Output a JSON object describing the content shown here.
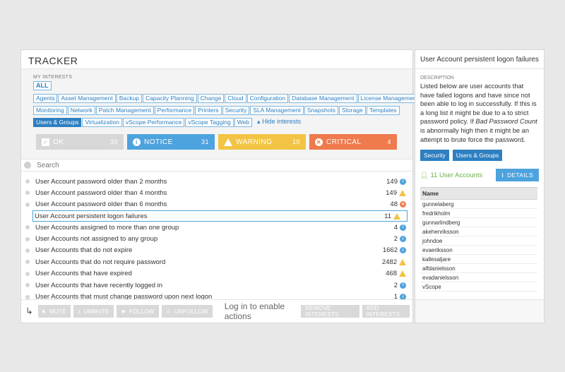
{
  "tracker": {
    "title": "TRACKER",
    "interests_label": "MY INTERESTS",
    "all_label": "ALL",
    "interest_rows": [
      [
        "Agents",
        "Asset Management",
        "Backup",
        "Capacity Planning",
        "Change",
        "Cloud",
        "Configuration",
        "Database Management",
        "License Management"
      ],
      [
        "Monitoring",
        "Network",
        "Patch Management",
        "Performance",
        "Printers",
        "Security",
        "SLA Management",
        "Snapshots",
        "Storage",
        "Templates"
      ],
      [
        "Users & Groups",
        "Virtualization",
        "vScope Performance",
        "vScope Tagging",
        "Web"
      ]
    ],
    "selected_interest": "Users & Groups",
    "hide_interests": "Hide interests",
    "severity": {
      "ok": {
        "label": "OK",
        "count": "30",
        "color": "#d7d7d7"
      },
      "notice": {
        "label": "NOTICE",
        "count": "31",
        "color": "#4da3de"
      },
      "warning": {
        "label": "WARNING",
        "count": "10",
        "color": "#f3c443"
      },
      "critical": {
        "label": "CRITICAL",
        "count": "4",
        "color": "#ef7a4d"
      }
    },
    "search_placeholder": "Search",
    "rows": [
      {
        "label": "User Account password older than 2 months",
        "count": "149",
        "sev": "notice"
      },
      {
        "label": "User Account password older than 4 months",
        "count": "149",
        "sev": "warning"
      },
      {
        "label": "User Account password older than 6 months",
        "count": "48",
        "sev": "critical"
      },
      {
        "label": "User Account persistent logon failures",
        "count": "11",
        "sev": "warning",
        "selected": true
      },
      {
        "label": "User Accounts assigned to more than one group",
        "count": "4",
        "sev": "notice"
      },
      {
        "label": "User Accounts not assigned to any group",
        "count": "2",
        "sev": "notice"
      },
      {
        "label": "User Accounts that do not expire",
        "count": "1662",
        "sev": "notice"
      },
      {
        "label": "User Accounts that do not require password",
        "count": "2482",
        "sev": "warning"
      },
      {
        "label": "User Accounts that have expired",
        "count": "468",
        "sev": "warning"
      },
      {
        "label": "User Accounts that have recently logged in",
        "count": "2",
        "sev": "notice"
      },
      {
        "label": "User Accounts that must change password upon next logon",
        "count": "1",
        "sev": "notice"
      }
    ],
    "footer": {
      "mute": "MUTE",
      "unmute": "UNMUTE",
      "follow": "FOLLOW",
      "unfollow": "UNFOLLOW",
      "login_note": "Log in to enable actions",
      "remove_interests": "REMOVE INTERESTS",
      "add_interests": "ADD INTERESTS"
    }
  },
  "detail": {
    "title": "User Account persistent logon failures",
    "description_label": "DESCRIPTION",
    "description_part1": "Listed below are user accounts that have failed logons and have since not been able to log in successfully. If this is a long list it might be due to a to strict password policy. If ",
    "description_em": "Bad Password Count",
    "description_part2": " is abnormally high then it might be an attempt to brute force the password.",
    "tags": [
      "Security",
      "Users & Groups"
    ],
    "accounts_text": "11 User Accounts",
    "details_button": "DETAILS",
    "table_header": "Name",
    "users": [
      "gunnelaberg",
      "fredrikholm",
      "gunnarlindberg",
      "akehenriksson",
      "johndoe",
      "evaeriksson",
      "kallesaljare",
      "alfdanielsson",
      "evadanielsson",
      "vScope"
    ]
  }
}
